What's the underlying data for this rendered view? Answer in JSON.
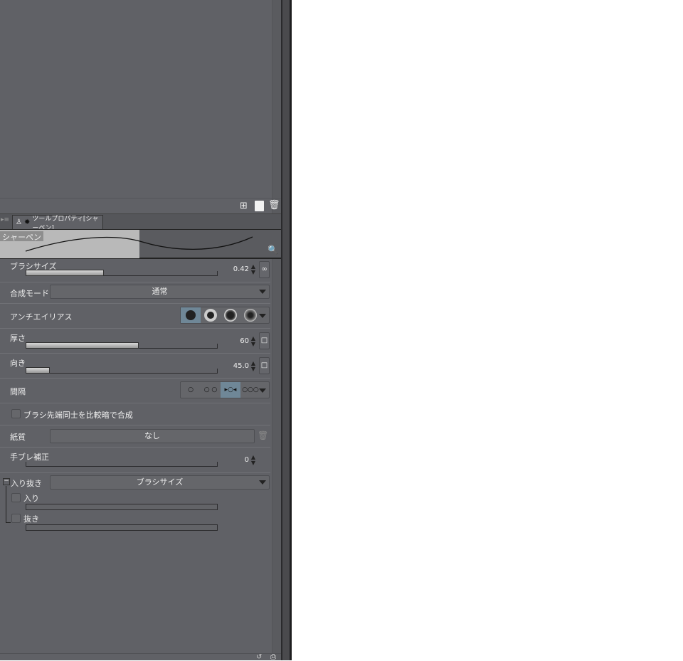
{
  "panel_tab": {
    "title": "ツールプロパティ[シャーペン]"
  },
  "preview": {
    "tool_name": "シャーペン"
  },
  "properties": {
    "brush_size": {
      "label": "ブラシサイズ",
      "value": "0.42",
      "fill": 0.41
    },
    "blend_mode": {
      "label": "合成モード",
      "value": "通常"
    },
    "antialias": {
      "label": "アンチエイリアス",
      "selected_index": 0
    },
    "thickness": {
      "label": "厚さ",
      "value": "60",
      "fill": 0.6
    },
    "direction": {
      "label": "向き",
      "value": "45.0",
      "fill": 0.125
    },
    "spacing": {
      "label": "間隔",
      "selected_index": 2
    },
    "compare_darken": {
      "label": "ブラシ先端同士を比較暗で合成",
      "checked": false
    },
    "paper_texture": {
      "label": "紙質",
      "value": "なし"
    },
    "stabilization": {
      "label": "手ブレ補正",
      "value": "0",
      "fill": 0
    },
    "taper": {
      "label": "入り抜き",
      "value": "ブラシサイズ",
      "start_label": "入り",
      "end_label": "抜き"
    }
  },
  "colors": {
    "panel": "#606166",
    "selected": "#6f8797"
  }
}
